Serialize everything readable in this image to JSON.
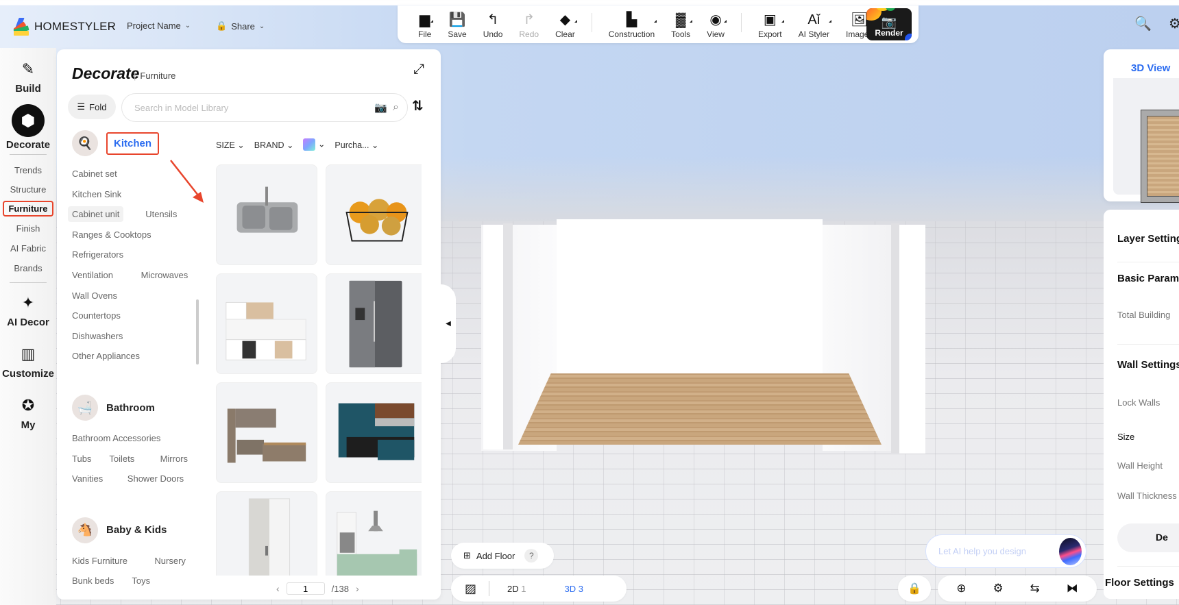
{
  "app": {
    "brand": "HOMESTYLER",
    "project_label": "Project Name",
    "share_label": "Share"
  },
  "toolbar": {
    "items": [
      {
        "label": "File",
        "icon": "folder-icon",
        "glyph": "▆",
        "has_menu": true,
        "disabled": false
      },
      {
        "label": "Save",
        "icon": "save-icon",
        "glyph": "💾",
        "has_menu": false,
        "disabled": false
      },
      {
        "label": "Undo",
        "icon": "undo-icon",
        "glyph": "↰",
        "has_menu": false,
        "disabled": false
      },
      {
        "label": "Redo",
        "icon": "redo-icon",
        "glyph": "↱",
        "has_menu": false,
        "disabled": true
      },
      {
        "label": "Clear",
        "icon": "eraser-icon",
        "glyph": "◆",
        "has_menu": true,
        "disabled": false
      },
      {
        "label": "Construction",
        "icon": "construction-icon",
        "glyph": "▙",
        "has_menu": true,
        "disabled": false
      },
      {
        "label": "Tools",
        "icon": "tools-icon",
        "glyph": "▓",
        "has_menu": true,
        "disabled": false
      },
      {
        "label": "View",
        "icon": "eye-icon",
        "glyph": "◉",
        "has_menu": true,
        "disabled": false
      },
      {
        "label": "Export",
        "icon": "export-icon",
        "glyph": "▣",
        "has_menu": true,
        "disabled": false
      },
      {
        "label": "AI Styler",
        "icon": "ai-styler-icon",
        "glyph": "Aǐ",
        "has_menu": true,
        "disabled": false
      },
      {
        "label": "Images",
        "icon": "images-icon",
        "glyph": "🖼",
        "has_menu": false,
        "disabled": false
      }
    ],
    "render_label": "Render"
  },
  "leftnav": {
    "build": "Build",
    "decorate": "Decorate",
    "subs": [
      "Trends",
      "Structure",
      "Furniture",
      "Finish",
      "AI Fabric",
      "Brands"
    ],
    "selected_sub": "Furniture",
    "ai_decor": "AI Decor",
    "customize": "Customize",
    "my": "My"
  },
  "panel": {
    "title": "Decorate",
    "subtitle": "Furniture",
    "fold_label": "Fold",
    "search_placeholder": "Search in Model Library",
    "filters": {
      "size": "SIZE",
      "brand": "BRAND",
      "purchase": "Purcha..."
    },
    "categories": [
      {
        "name": "Kitchen",
        "active": true,
        "icon": "🍳",
        "rows": [
          [
            "Cabinet set"
          ],
          [
            "Kitchen Sink"
          ],
          [
            "Cabinet unit",
            "Utensils"
          ],
          [
            "Ranges & Cooktops"
          ],
          [
            "Refrigerators"
          ],
          [
            "Ventilation",
            "Microwaves"
          ],
          [
            "Wall Ovens"
          ],
          [
            "Countertops"
          ],
          [
            "Dishwashers"
          ],
          [
            "Other Appliances"
          ]
        ]
      },
      {
        "name": "Bathroom",
        "active": false,
        "icon": "🛁",
        "rows": [
          [
            "Bathroom Accessories"
          ],
          [
            "Tubs",
            "Toilets",
            "Mirrors"
          ],
          [
            "Vanities",
            "Shower Doors"
          ]
        ]
      },
      {
        "name": "Baby & Kids",
        "active": false,
        "icon": "🐴",
        "rows": [
          [
            "Kids Furniture",
            "Nursery"
          ],
          [
            "Bunk beds",
            "Toys"
          ]
        ]
      }
    ],
    "products": [
      "Stainless double kitchen sink",
      "Wire basket with pumpkins",
      "White and wood kitchen set",
      "Side-by-side refrigerator",
      "Wood kitchen with island",
      "Teal kitchen with bar stools",
      "White bottom-freezer refrigerator",
      "Sage green L-shaped kitchen"
    ],
    "pager": {
      "current": "1",
      "total": "/138"
    }
  },
  "right": {
    "view_tab": "3D View",
    "layer_settings": "Layer Settings",
    "basic_params": "Basic Parameters",
    "total_building": "Total Building",
    "wall_settings": "Wall Settings",
    "lock_walls": "Lock Walls",
    "size": "Size",
    "wall_height": "Wall Height",
    "wall_thickness": "Wall Thickness",
    "button_label": "De",
    "floor_settings": "Floor Settings"
  },
  "bottom": {
    "add_floor": "Add Floor",
    "help": "?",
    "view_2d": "2D",
    "view_2d_count": "1",
    "view_3d": "3D 3",
    "ai_placeholder": "Let AI help you design"
  },
  "colors": {
    "accent": "#2b6cf0",
    "highlight": "#e8452c"
  }
}
